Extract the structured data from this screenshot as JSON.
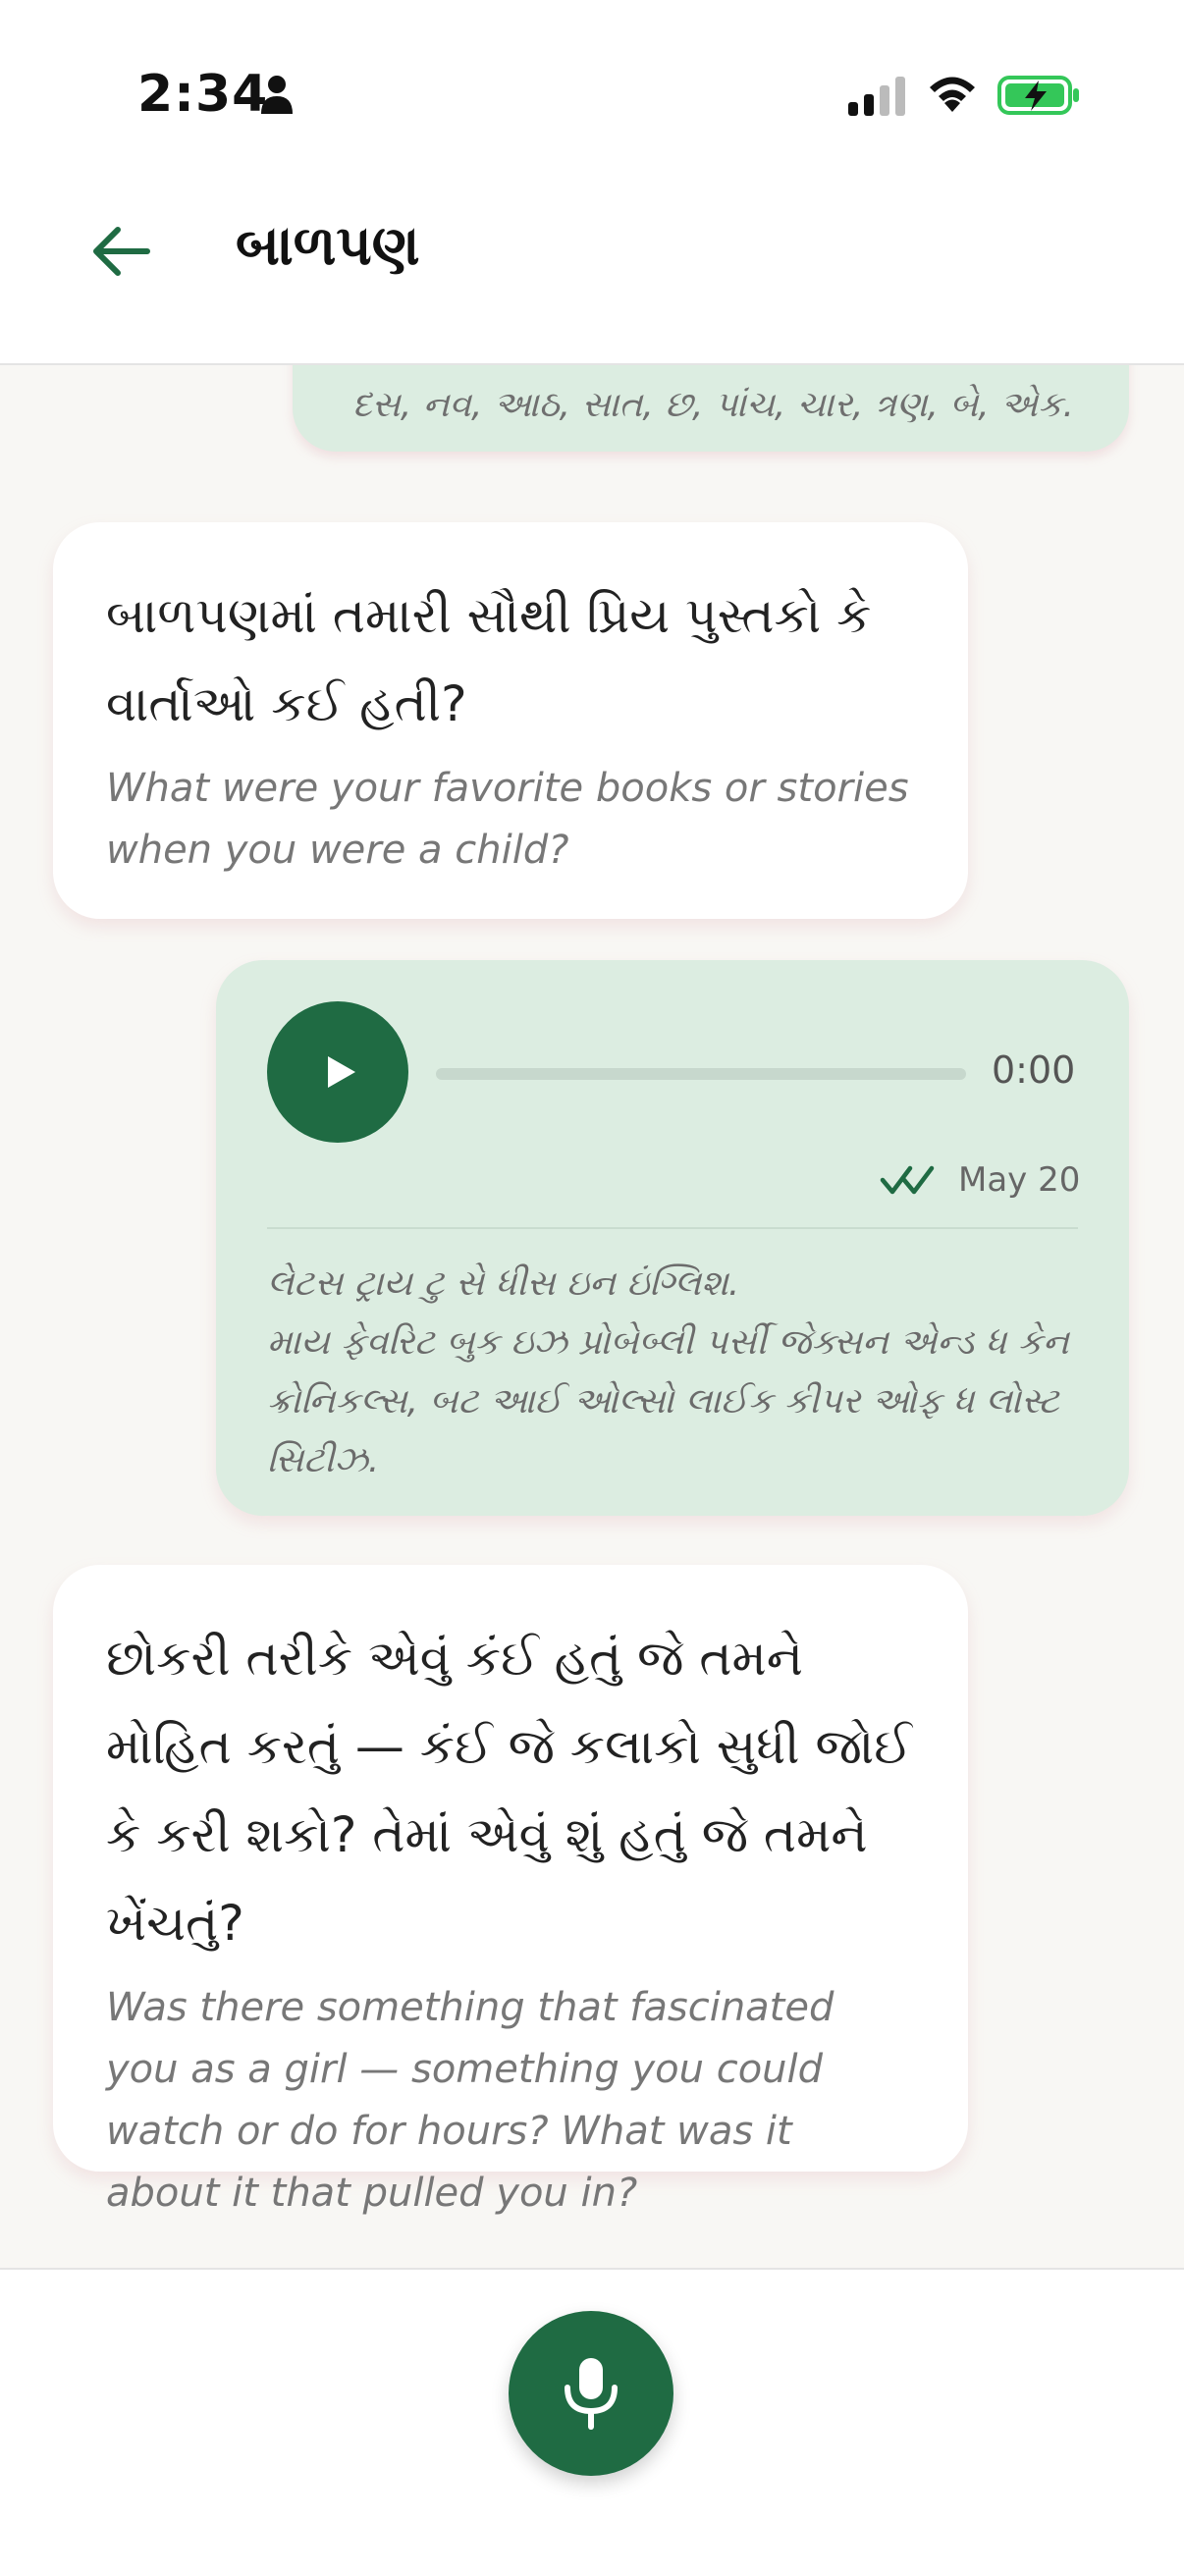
{
  "status_bar": {
    "time": "2:34",
    "icons": [
      "person-icon",
      "cellular-signal-icon",
      "wifi-icon",
      "battery-charging-icon"
    ],
    "battery_color": "#34c759"
  },
  "header": {
    "back_icon": "arrow-left-icon",
    "title": "બાળપણ"
  },
  "colors": {
    "accent": "#1f6b43",
    "user_bubble": "#dcede1",
    "question_bubble": "#ffffff",
    "background": "#f8f7f4"
  },
  "messages": {
    "previous_answer_tail": "દસ, નવ, આઠ, સાત, છ, પાંચ, ચાર, ત્રણ, બે, એક.",
    "question_1": {
      "gujarati": "બાળપણમાં તમારી સૌથી પ્રિય પુસ્તકો કે વાર્તાઓ કઈ હતી?",
      "english": "What were your favorite books or stories when you were a child?"
    },
    "audio_answer": {
      "duration": "0:00",
      "progress": 0,
      "status_icon": "double-check-icon",
      "date": "May 20",
      "transcript_line_1": "લેટસ ટ્રાય ટુ સે ધીસ ઇન ઇંગ્લિશ.",
      "transcript_line_2": "માય ફેવરિટ બુક ઇઝ પ્રોબેબ્લી પર્સી જેક્સન એન્ડ ધ કેન ક્રોનિકલ્સ, બટ આઈ ઓલ્સો લાઈક કીપર ઓફ ધ લોસ્ટ સિટીઝ."
    },
    "question_2": {
      "gujarati": "છોકરી તરીકે એવું કંઈ હતું જે તમને મોહિત કરતું — કંઈ જે કલાકો સુધી જોઈ કે કરી શકો? તેમાં એવું શું હતું જે તમને ખેંચતું?",
      "english": "Was there something that fascinated you as a girl — something you could watch or do for hours? What was it about it that pulled you in?"
    }
  },
  "footer": {
    "mic_icon": "microphone-icon"
  }
}
